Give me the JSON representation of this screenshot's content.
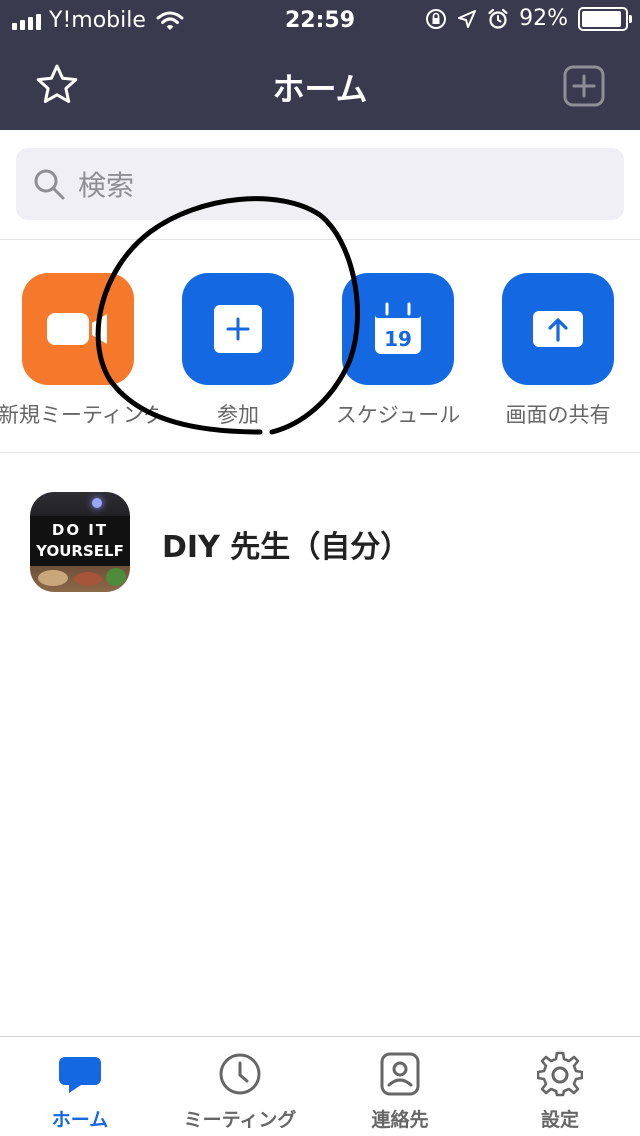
{
  "status_bar": {
    "carrier": "Y!mobile",
    "time": "22:59",
    "battery_percent": "92%",
    "battery_level": 0.92,
    "icons": [
      "signal-icon",
      "wifi-icon",
      "rotation-lock-icon",
      "location-icon",
      "alarm-icon",
      "battery-icon"
    ]
  },
  "nav": {
    "title": "ホーム",
    "left_icon": "star-icon",
    "right_icon": "plus-square-icon"
  },
  "search": {
    "placeholder": "検索",
    "icon": "search-icon"
  },
  "actions": [
    {
      "label": "新規ミーティング",
      "icon": "video-camera-icon",
      "color": "#f5782b"
    },
    {
      "label": "参加",
      "icon": "plus-icon",
      "color": "#1469e3"
    },
    {
      "label": "スケジュール",
      "icon": "calendar-icon",
      "calendar_day": "19",
      "color": "#1469e3"
    },
    {
      "label": "画面の共有",
      "icon": "share-screen-icon",
      "color": "#1469e3"
    }
  ],
  "contact": {
    "name": "DIY 先生（自分）",
    "avatar_text_line1": "DO IT",
    "avatar_text_line2": "YOURSELF"
  },
  "tabs": [
    {
      "label": "ホーム",
      "icon": "chat-bubble-icon",
      "active": true
    },
    {
      "label": "ミーティング",
      "icon": "clock-icon",
      "active": false
    },
    {
      "label": "連絡先",
      "icon": "contact-icon",
      "active": false
    },
    {
      "label": "設定",
      "icon": "gear-icon",
      "active": false
    }
  ],
  "colors": {
    "header": "#3a3a4e",
    "accent": "#1469e3",
    "orange": "#f5782b"
  }
}
